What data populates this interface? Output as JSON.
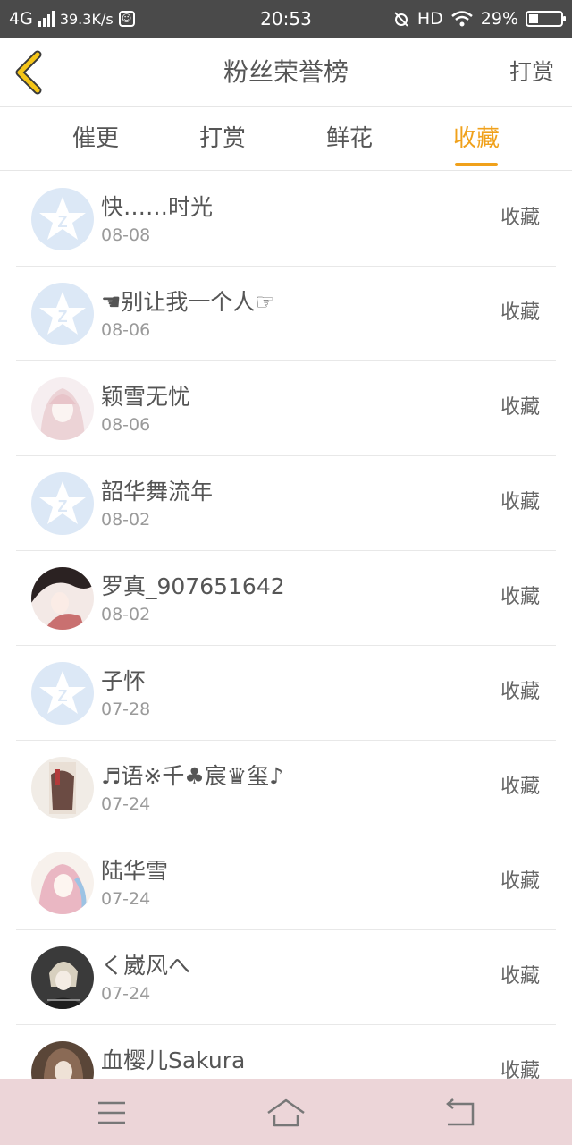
{
  "status_bar": {
    "network": "4G",
    "speed": "39.3K/s",
    "time": "20:53",
    "hd": "HD",
    "battery": "29%",
    "battery_level": 0.29
  },
  "header": {
    "title": "粉丝荣誉榜",
    "right_action": "打赏"
  },
  "tabs": [
    {
      "label": "催更",
      "active": false
    },
    {
      "label": "打赏",
      "active": false
    },
    {
      "label": "鲜花",
      "active": false
    },
    {
      "label": "收藏",
      "active": true
    }
  ],
  "list": [
    {
      "name": "快……时光",
      "date": "08-08",
      "action": "收藏",
      "avatar": "default-avatar-icon"
    },
    {
      "name": "☚别让我一个人☞",
      "date": "08-06",
      "action": "收藏",
      "avatar": "default-avatar-icon"
    },
    {
      "name": "颖雪无忧",
      "date": "08-06",
      "action": "收藏",
      "avatar": "user-photo"
    },
    {
      "name": "韶华舞流年",
      "date": "08-02",
      "action": "收藏",
      "avatar": "default-avatar-icon"
    },
    {
      "name": "罗真_907651642",
      "date": "08-02",
      "action": "收藏",
      "avatar": "user-photo"
    },
    {
      "name": "子怀",
      "date": "07-28",
      "action": "收藏",
      "avatar": "default-avatar-icon"
    },
    {
      "name": "♬语※千♣宸♛玺♪",
      "date": "07-24",
      "action": "收藏",
      "avatar": "user-photo"
    },
    {
      "name": "陆华雪",
      "date": "07-24",
      "action": "收藏",
      "avatar": "user-photo"
    },
    {
      "name": "く崴风へ",
      "date": "07-24",
      "action": "收藏",
      "avatar": "user-photo"
    },
    {
      "name": "血樱儿Sakura",
      "date": "",
      "action": "收藏",
      "avatar": "user-photo"
    }
  ],
  "colors": {
    "accent": "#f0a11b",
    "status_bar_bg": "#4a4a4a",
    "nav_bar_bg": "#ecd5d8",
    "default_avatar_bg": "#dce8f6"
  },
  "nav_bar": {
    "icons": [
      "menu-icon",
      "home-icon",
      "back-icon"
    ]
  }
}
